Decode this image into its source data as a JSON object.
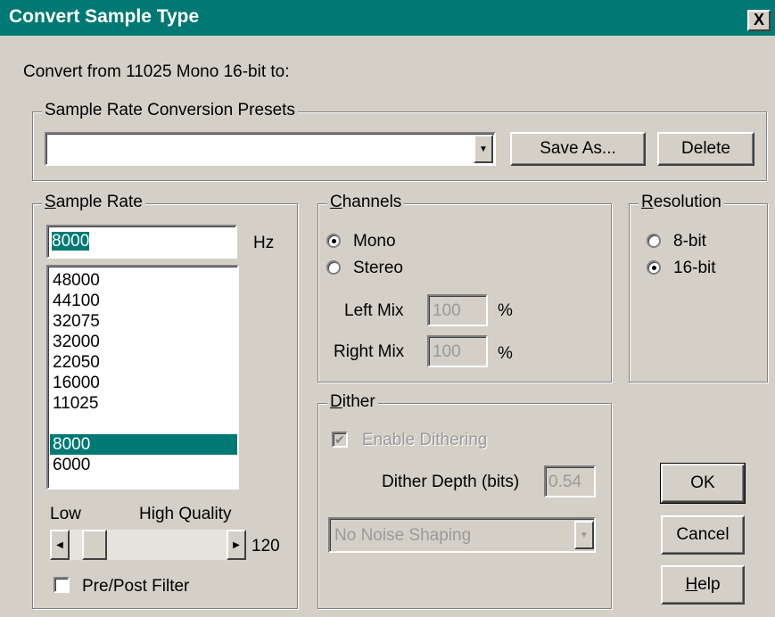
{
  "title": "Convert Sample Type",
  "close_label": "X",
  "convert_from": "Convert from 11025 Mono 16-bit to:",
  "presets": {
    "title": "Sample Rate Conversion Presets",
    "value": "",
    "save_as": "Save As...",
    "delete": "Delete"
  },
  "sample_rate": {
    "title": "Sample Rate",
    "value": "8000",
    "unit": "Hz",
    "items": [
      "48000",
      "44100",
      "32075",
      "32000",
      "22050",
      "16000",
      "11025",
      "8000",
      "6000"
    ],
    "selected": "8000",
    "low_label": "Low",
    "high_label": "High Quality",
    "slider_value": "120",
    "slider_level_fraction": 0.08,
    "filter_label": "Pre/Post Filter",
    "filter_checked": false
  },
  "channels": {
    "title": "Channels",
    "mono": "Mono",
    "stereo": "Stereo",
    "selected": "Mono",
    "left_mix_label": "Left Mix",
    "left_mix_value": "100",
    "right_mix_label": "Right Mix",
    "right_mix_value": "100",
    "percent": "%"
  },
  "resolution": {
    "title": "Resolution",
    "bit8": "8-bit",
    "bit16": "16-bit",
    "selected": "16-bit"
  },
  "dither": {
    "title": "Dither",
    "enable_label": "Enable Dithering",
    "enable_checked": true,
    "depth_label": "Dither Depth (bits)",
    "depth_value": "0.54",
    "noise_shaping": "No Noise Shaping"
  },
  "buttons": {
    "ok": "OK",
    "cancel": "Cancel",
    "help": "Help"
  },
  "colors": {
    "title_bar": "#007873",
    "face": "#d4d0c8",
    "selection": "#007873"
  }
}
